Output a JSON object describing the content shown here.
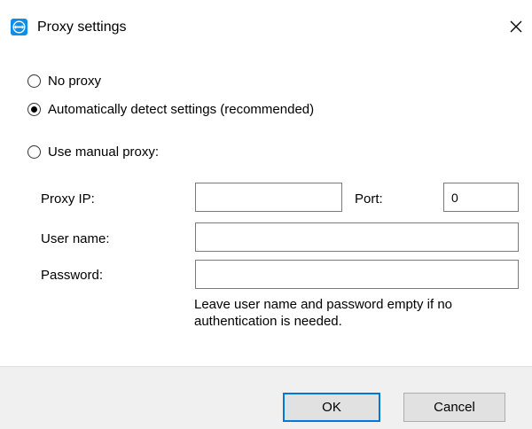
{
  "window": {
    "title": "Proxy settings",
    "app_icon": "teamviewer-logo-icon",
    "close_icon": "close-icon"
  },
  "proxy_options": [
    {
      "label": "No proxy",
      "checked": false
    },
    {
      "label": "Automatically detect settings (recommended)",
      "checked": true
    },
    {
      "label": "Use manual proxy:",
      "checked": false
    }
  ],
  "manual": {
    "proxy_ip_label": "Proxy IP:",
    "proxy_ip_value": "",
    "port_label": "Port:",
    "port_value": "0",
    "username_label": "User name:",
    "username_value": "",
    "password_label": "Password:",
    "password_value": "",
    "hint": "Leave user name and password empty if no authentication is needed."
  },
  "buttons": {
    "ok": "OK",
    "cancel": "Cancel"
  },
  "colors": {
    "accent": "#0078d7",
    "icon_blue": "#0e8ee9",
    "footer_bg": "#f0f0f0"
  }
}
